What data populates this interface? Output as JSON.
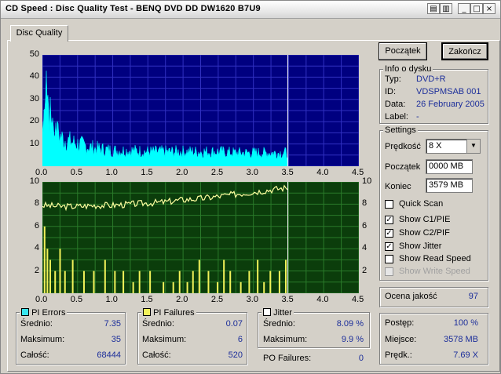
{
  "window": {
    "title": "CD Speed : Disc Quality Test - BENQ    DVD DD DW1620    B7U9",
    "btn_min": "_",
    "btn_max": "□",
    "btn_close": "×"
  },
  "tab": {
    "label": "Disc Quality"
  },
  "buttons": {
    "start": "Początek",
    "stop": "Zakończ"
  },
  "disc_info": {
    "title": "Info o dysku",
    "type_label": "Typ:",
    "type_value": "DVD+R",
    "id_label": "ID:",
    "id_value": "VDSPMSAB 001",
    "date_label": "Data:",
    "date_value": "26 February 2005",
    "label_label": "Label:",
    "label_value": "-"
  },
  "settings": {
    "title": "Settings",
    "speed_label": "Prędkość",
    "speed_value": "8 X",
    "start_label": "Początek",
    "start_value": "0000 MB",
    "end_label": "Koniec",
    "end_value": "3579 MB",
    "checks": [
      {
        "label": "Quick Scan",
        "checked": false,
        "enabled": true
      },
      {
        "label": "Show C1/PIE",
        "checked": true,
        "enabled": true
      },
      {
        "label": "Show C2/PIF",
        "checked": true,
        "enabled": true
      },
      {
        "label": "Show Jitter",
        "checked": true,
        "enabled": true
      },
      {
        "label": "Show Read Speed",
        "checked": false,
        "enabled": true
      },
      {
        "label": "Show Write Speed",
        "checked": false,
        "enabled": false
      }
    ]
  },
  "quality": {
    "label": "Ocena jakość",
    "value": "97"
  },
  "progress": {
    "progress_label": "Postęp:",
    "progress_value": "100 %",
    "place_label": "Miejsce:",
    "place_value": "3578 MB",
    "speed_label": "Prędk.:",
    "speed_value": "7.69 X"
  },
  "pi_errors": {
    "title": "PI Errors",
    "avg_label": "Średnio:",
    "avg_value": "7.35",
    "max_label": "Maksimum:",
    "max_value": "35",
    "total_label": "Całość:",
    "total_value": "68444",
    "color": "#39e6ef"
  },
  "pi_failures": {
    "title": "PI Failures",
    "avg_label": "Średnio:",
    "avg_value": "0.07",
    "max_label": "Maksimum:",
    "max_value": "6",
    "total_label": "Całość:",
    "total_value": "520",
    "color": "#f2f25a"
  },
  "jitter": {
    "title": "Jitter",
    "avg_label": "Średnio:",
    "avg_value": "8.09 %",
    "max_label": "Maksimum:",
    "max_value": "9.9 %",
    "color": "#ffffff"
  },
  "po_failures": {
    "label": "PO Failures:",
    "value": "0"
  },
  "chart_data": [
    {
      "type": "area",
      "title": "PI Errors",
      "x_ticks": [
        "0.0",
        "0.5",
        "1.0",
        "1.5",
        "2.0",
        "2.5",
        "3.0",
        "3.5",
        "4.0",
        "4.5"
      ],
      "y_ticks": [
        "50",
        "40",
        "30",
        "20",
        "10"
      ],
      "xlim": [
        0,
        4.5
      ],
      "ylim": [
        0,
        50
      ],
      "marker_x": 3.49,
      "series": [
        {
          "x": [
            0.0,
            0.05,
            0.1,
            0.2,
            0.3,
            0.5,
            0.75,
            1.0,
            1.25,
            1.5,
            1.75,
            2.0,
            2.25,
            2.5,
            2.75,
            3.0,
            3.25,
            3.49
          ],
          "values": [
            20,
            35,
            22,
            15,
            12,
            10,
            8,
            7,
            7,
            6.5,
            6.5,
            6.5,
            6.5,
            6.5,
            6,
            6,
            6,
            6
          ]
        }
      ],
      "colors": {
        "bg": "#000080",
        "grid": "#3030c0",
        "fill": "#00ffff"
      }
    },
    {
      "type": "bar",
      "title": "PI Failures / Jitter",
      "x_ticks": [
        "0.0",
        "0.5",
        "1.0",
        "1.5",
        "2.0",
        "2.5",
        "3.0",
        "3.5",
        "4.0",
        "4.5"
      ],
      "y_ticks_left": [
        "10",
        "8",
        "6",
        "4",
        "2"
      ],
      "y_ticks_right": [
        "10",
        "8",
        "6",
        "4",
        "2"
      ],
      "xlim": [
        0,
        4.5
      ],
      "ylim": [
        0,
        10
      ],
      "marker_x": 3.49,
      "series": [
        {
          "kind": "bars",
          "x": [
            0.02,
            0.06,
            0.1,
            0.17,
            0.24,
            0.31,
            0.42,
            0.58,
            0.72,
            0.88,
            1.02,
            1.14,
            1.28,
            1.37,
            1.52,
            1.71,
            1.85,
            1.94,
            2.05,
            2.13,
            2.22,
            2.35,
            2.48,
            2.57,
            2.66,
            2.81,
            2.93,
            3.05,
            3.14,
            3.23,
            3.36,
            3.45
          ],
          "values": [
            6,
            4,
            3,
            2,
            4,
            2,
            3,
            2,
            2,
            3,
            2,
            2,
            1,
            2,
            2,
            1,
            1,
            2,
            1,
            2,
            3,
            2,
            1,
            3,
            2,
            1,
            2,
            3,
            1,
            2,
            2,
            3
          ]
        },
        {
          "kind": "line",
          "name": "Jitter",
          "x": [
            0.0,
            0.25,
            0.5,
            0.75,
            1.0,
            1.25,
            1.5,
            1.75,
            2.0,
            2.25,
            2.5,
            2.75,
            3.0,
            3.25,
            3.49
          ],
          "values": [
            7.9,
            7.8,
            7.8,
            7.9,
            7.9,
            8.0,
            8.1,
            8.2,
            8.4,
            8.5,
            8.7,
            8.9,
            9.1,
            9.3,
            9.5
          ]
        }
      ],
      "colors": {
        "bg": "#0b3d0b",
        "grid": "#2a7a2a",
        "bars": "#f2f25a",
        "line": "#ffffa0"
      }
    }
  ]
}
